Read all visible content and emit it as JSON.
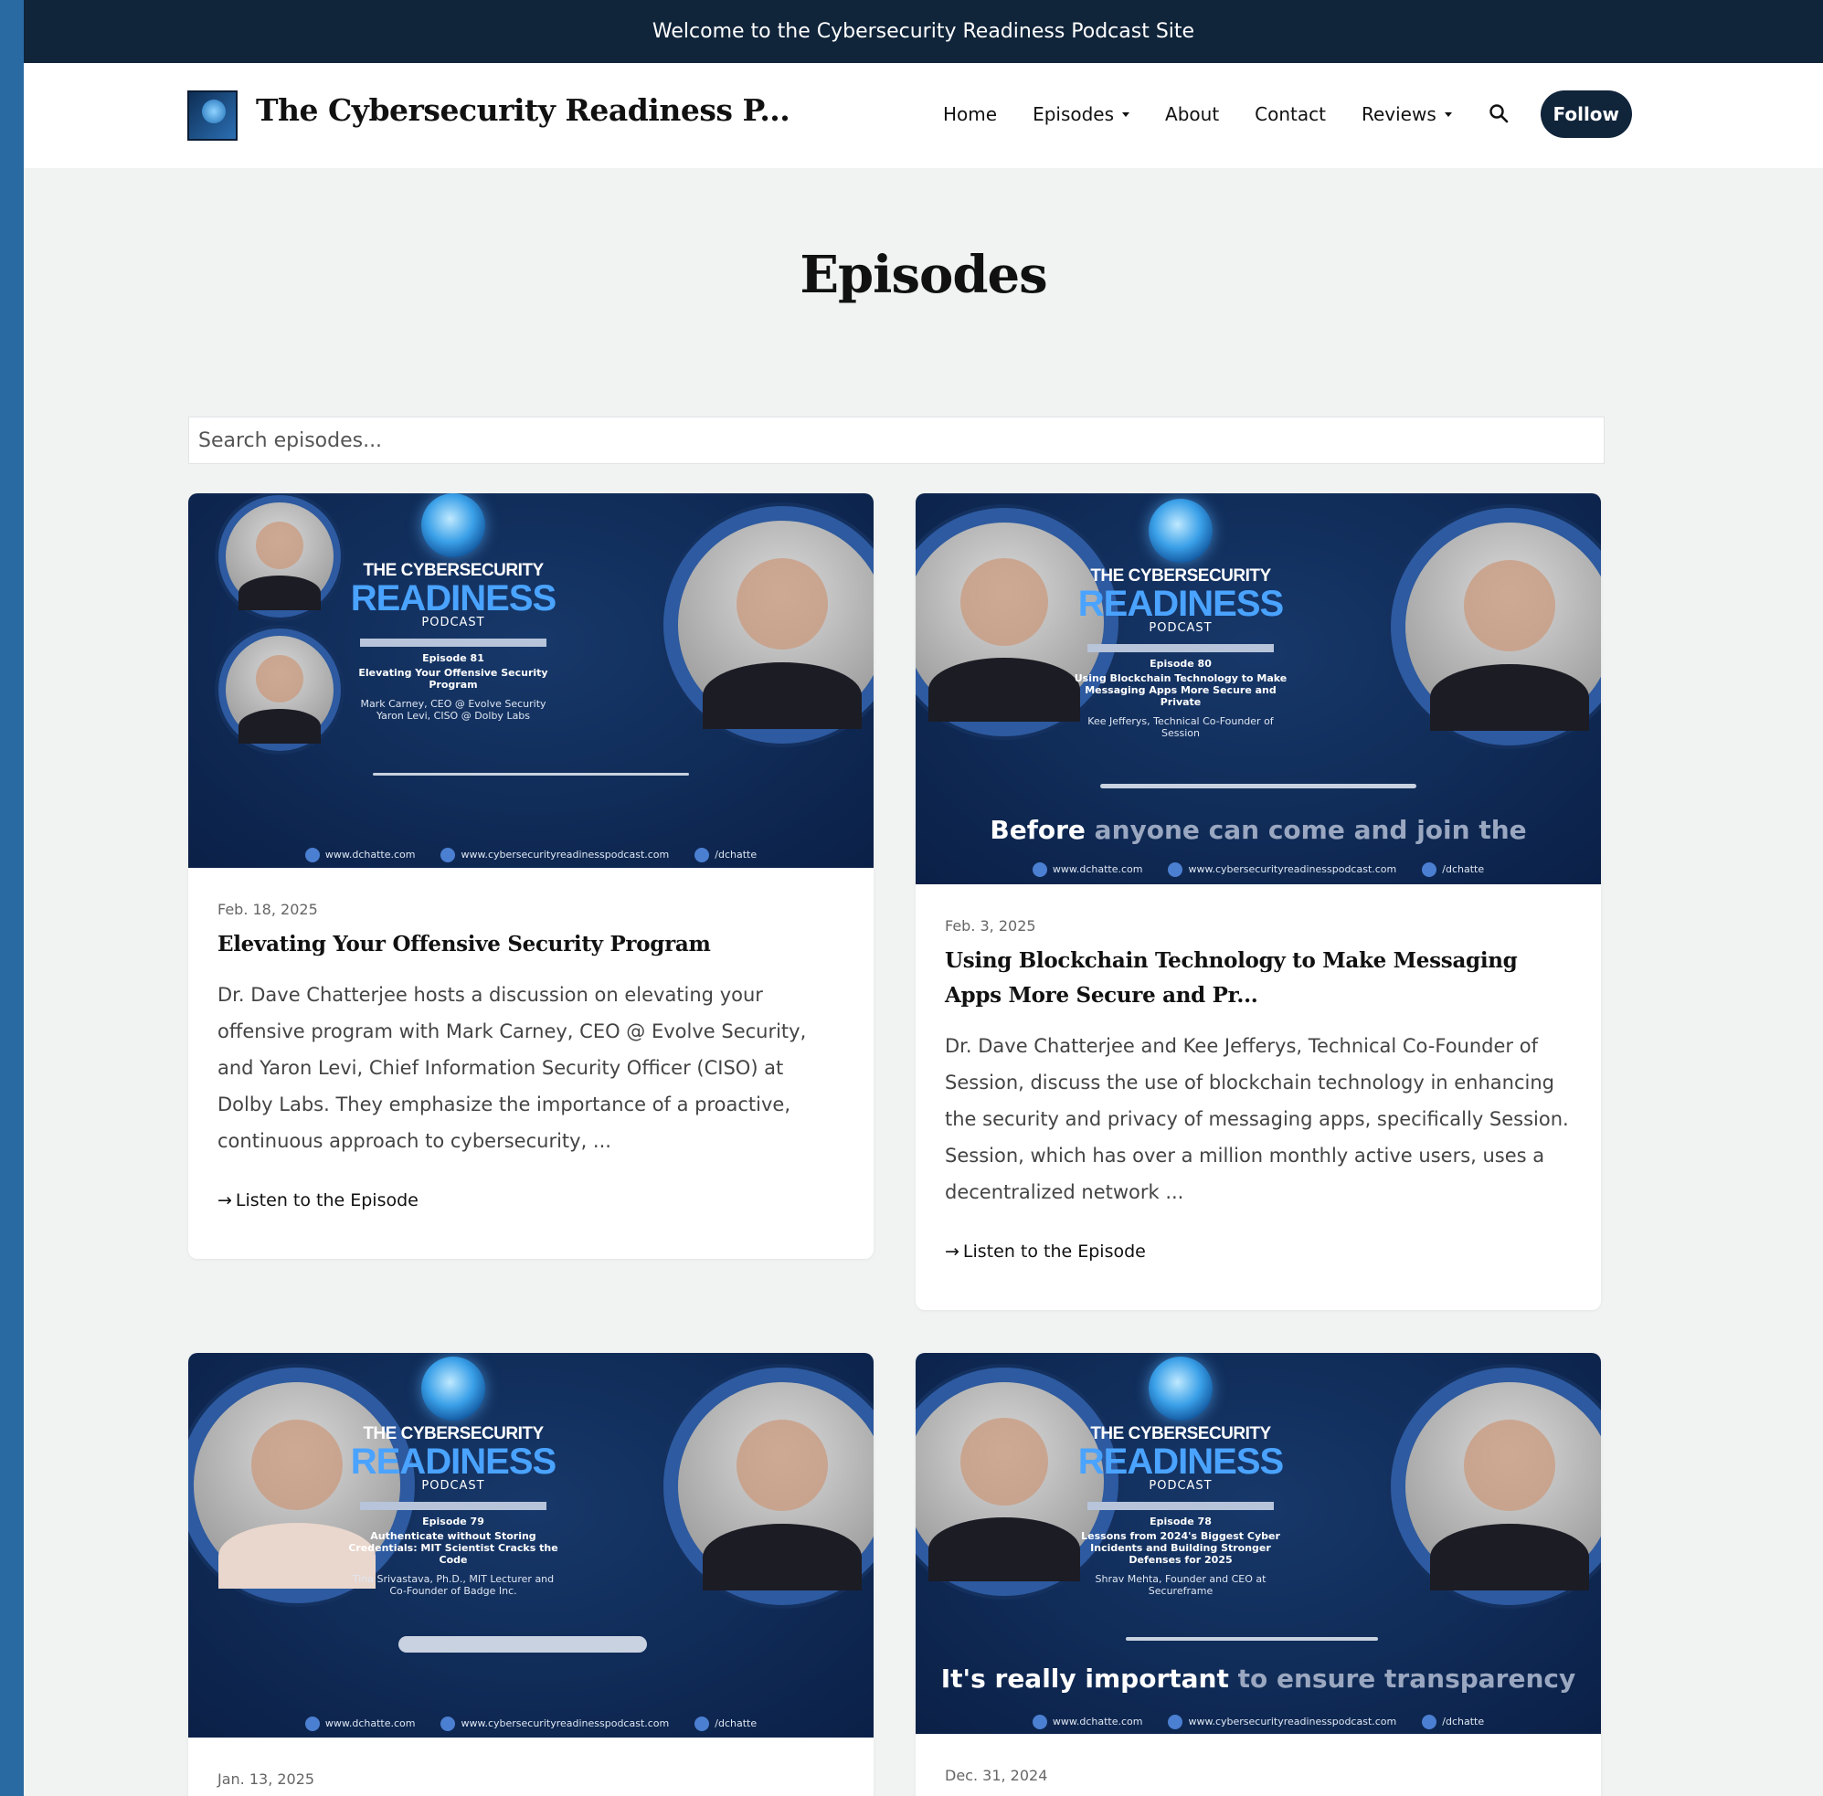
{
  "announcement": "Welcome to the Cybersecurity Readiness Podcast Site",
  "header": {
    "site_title": "The Cybersecurity Readiness P...",
    "nav": [
      {
        "label": "Home",
        "dropdown": false
      },
      {
        "label": "Episodes",
        "dropdown": true
      },
      {
        "label": "About",
        "dropdown": false
      },
      {
        "label": "Contact",
        "dropdown": false
      },
      {
        "label": "Reviews",
        "dropdown": true
      }
    ],
    "search_icon": "search-icon",
    "follow_label": "Follow"
  },
  "page_title": "Episodes",
  "search": {
    "placeholder": "Search episodes..."
  },
  "listen_label": "Listen to the Episode",
  "listen_arrow": "→",
  "thumb_brand": {
    "line1": "THE CYBERSECURITY",
    "line2": "READINESS",
    "line3": "PODCAST",
    "links": [
      "www.dchatte.com",
      "www.cybersecurityreadinesspodcast.com",
      "/dchatte"
    ]
  },
  "episodes": [
    {
      "date": "Feb. 18, 2025",
      "title": "Elevating Your Offensive Security Program",
      "excerpt": "Dr. Dave Chatterjee hosts a discussion on elevating your offensive program with Mark Carney, CEO @ Evolve Security, and Yaron Levi, Chief Information Security Officer (CISO) at Dolby Labs. They emphasize the importance of a proactive, continuous approach to cybersecurity, ...",
      "thumb": {
        "episode": "Episode 81",
        "episode_title": "Elevating Your Offensive Security Program",
        "guests": "Mark Carney, CEO @ Evolve Security\nYaron Levi, CISO @ Dolby Labs",
        "quote_bright": "",
        "quote_dim": ""
      }
    },
    {
      "date": "Feb. 3, 2025",
      "title": "Using Blockchain Technology to Make Messaging Apps More Secure and Pr...",
      "excerpt": "Dr. Dave Chatterjee and Kee Jefferys, Technical Co-Founder of Session, discuss the use of blockchain technology in enhancing the security and privacy of messaging apps, specifically Session. Session, which has over a million monthly active users, uses a decentralized network ...",
      "thumb": {
        "episode": "Episode 80",
        "episode_title": "Using Blockchain Technology to Make Messaging Apps More Secure and Private",
        "guests": "Kee Jefferys, Technical Co-Founder of Session",
        "quote_bright": "Before",
        "quote_dim": "anyone can come and join the"
      }
    },
    {
      "date": "Jan. 13, 2025",
      "title": "",
      "excerpt": "",
      "thumb": {
        "episode": "Episode 79",
        "episode_title": "Authenticate without Storing Credentials: MIT Scientist Cracks the Code",
        "guests": "Tina Srivastava, Ph.D., MIT Lecturer and Co-Founder of Badge Inc.",
        "quote_bright": "",
        "quote_dim": ""
      }
    },
    {
      "date": "Dec. 31, 2024",
      "title": "",
      "excerpt": "",
      "thumb": {
        "episode": "Episode 78",
        "episode_title": "Lessons from 2024's Biggest Cyber Incidents and Building Stronger Defenses for 2025",
        "guests": "Shrav Mehta, Founder and CEO at Secureframe",
        "quote_bright": "It's really important",
        "quote_dim": "to ensure transparency"
      }
    }
  ]
}
